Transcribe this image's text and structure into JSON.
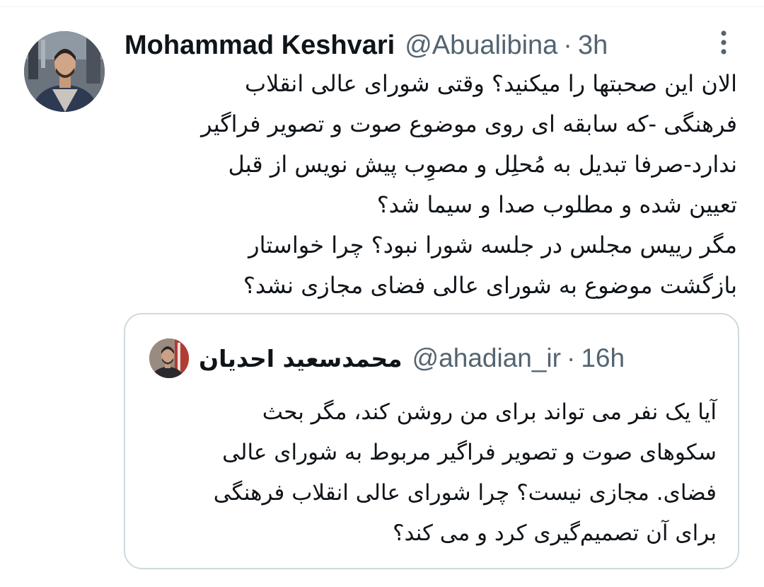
{
  "tweet": {
    "author": {
      "display_name": "Mohammad Keshvari",
      "handle": "@Abualibina",
      "separator": "·",
      "time": "3h",
      "avatar": "profile-photo"
    },
    "more_icon": "more-vertical-icon",
    "text_lines": [
      "الان این صحبتها را میکنید؟  وقتی شورای عالی انقلاب",
      "فرهنگی -که سابقه ای روی موضوع صوت و تصویر فراگیر",
      "ندارد-صرفا تبدیل به مُحلِل و مصوِب پیش نویس از قبل",
      "تعیین شده و مطلوب صدا و سیما شد؟",
      "مگر رییس مجلس در جلسه شورا نبود؟ چرا خواستار",
      "بازگشت موضوع به شورای عالی فضای مجازی نشد؟"
    ]
  },
  "quoted_tweet": {
    "author": {
      "display_name": "محمدسعید احدیان",
      "handle": "@ahadian_ir",
      "separator": "·",
      "time": "16h",
      "avatar": "profile-photo"
    },
    "text_lines": [
      "آیا  یک نفر می تواند برای من روشن کند، مگر بحث",
      "سکوهای صوت و تصویر فراگیر مربوط به شورای عالی",
      "فضای. مجازی نیست؟ چرا شورای عالی انقلاب فرهنگی",
      "برای آن تصمیم‌گیری کرد و  می کند؟"
    ]
  },
  "colors": {
    "text_primary": "#0f1419",
    "text_secondary": "#536471",
    "border": "#cfd9de",
    "background": "#ffffff"
  }
}
